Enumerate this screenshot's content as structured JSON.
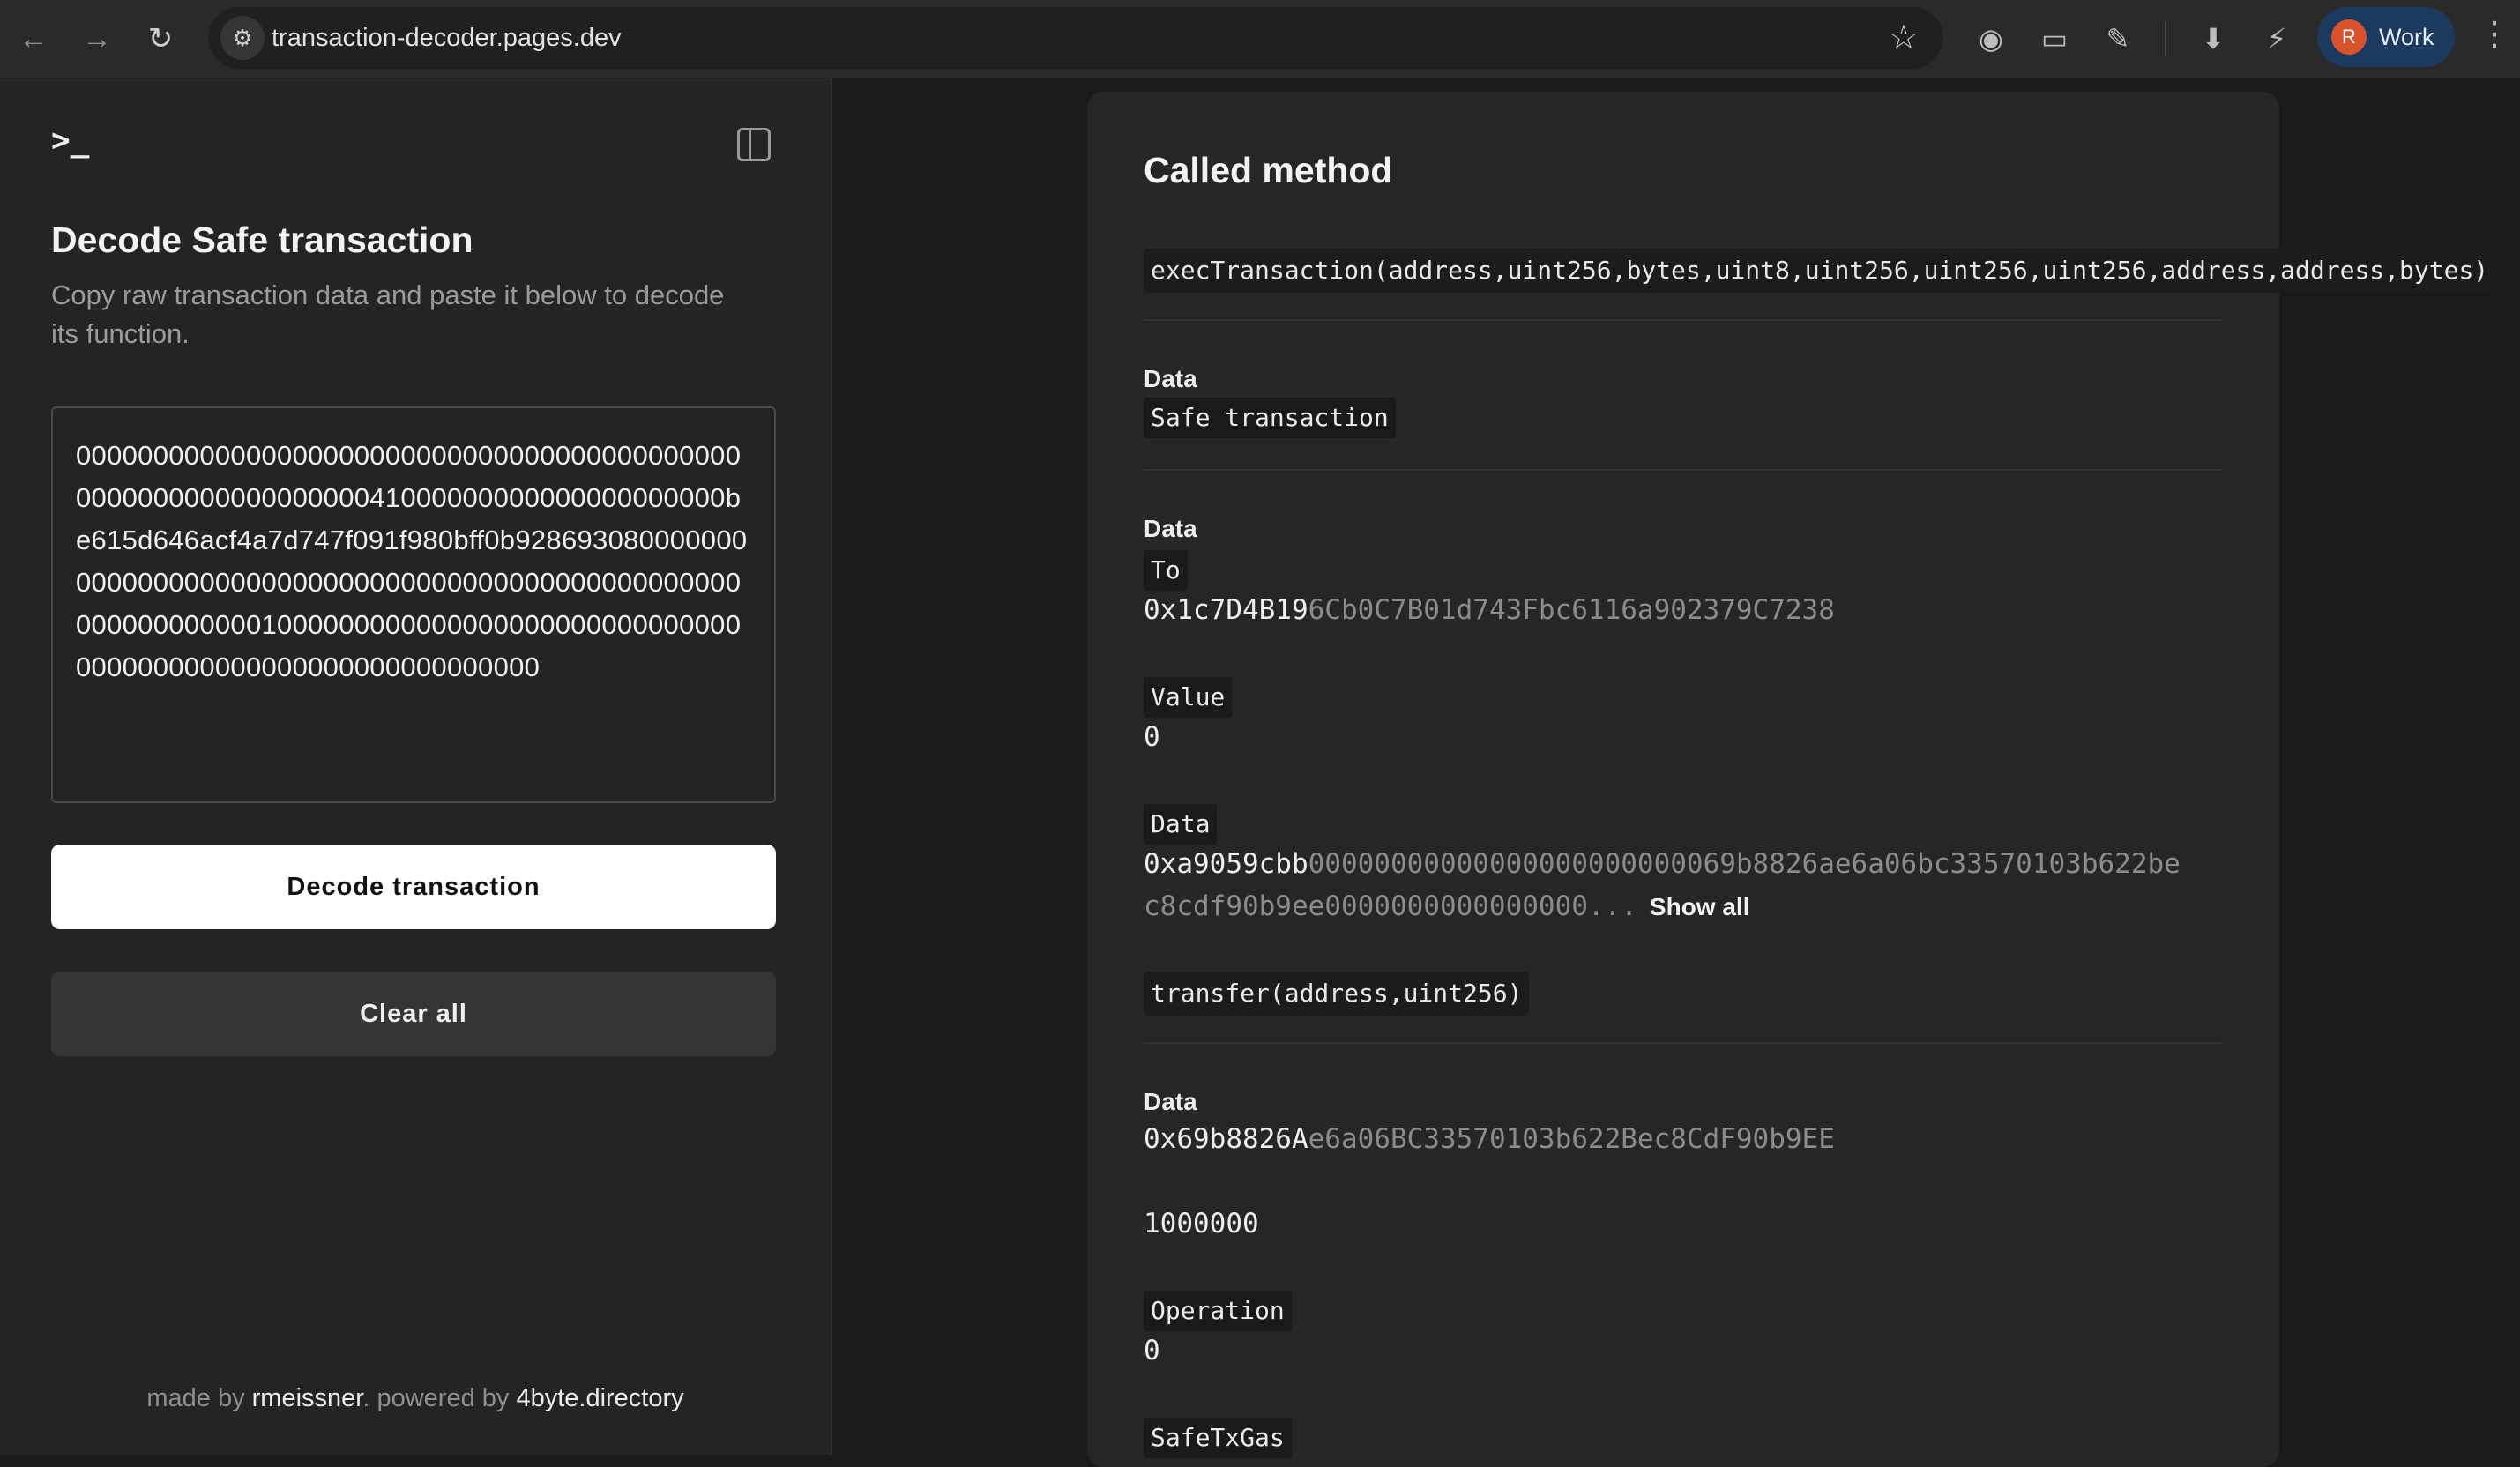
{
  "browser": {
    "url": "transaction-decoder.pages.dev",
    "profile_initial": "R",
    "profile_label": "Work"
  },
  "sidebar": {
    "title": "Decode Safe transaction",
    "subtitle": "Copy raw transaction data and paste it below to decode its function.",
    "raw_input_value": "0000000000000000000000000000000000000000000000000000000000000041000000000000000000000be615d646acf4a7d747f091f980bff0b92869308000000000000000000000000000000000000000000000000000000000000001000000000000000000000000000000000000000000000000000000000000",
    "decode_button": "Decode transaction",
    "clear_button": "Clear all",
    "footer": {
      "made_by_prefix": "made by ",
      "author": "rmeissner",
      "powered_prefix": ". powered by ",
      "powered_link": "4byte.directory"
    }
  },
  "result": {
    "title": "Called method",
    "method_signature": "execTransaction(address,uint256,bytes,uint8,uint256,uint256,uint256,address,address,bytes)",
    "section1": {
      "label": "Data",
      "value": "Safe transaction"
    },
    "section2": {
      "label": "Data",
      "to_tag": "To",
      "to_value_bold": "0x1c7D4B19",
      "to_value_dim": "6Cb0C7B01d743Fbc6116a902379C7238",
      "value_tag": "Value",
      "value_value": "0",
      "data_tag": "Data",
      "data_value_bold": "0xa9059cbb",
      "data_value_dim1": "00000000000000000000000069b8826ae6a06bc33570103b622be",
      "data_value_dim2": "c8cdf90b9ee0000000000000000...",
      "show_all": "Show all",
      "inner_method": "transfer(address,uint256)"
    },
    "section3": {
      "label": "Data",
      "address_bold": "0x69b8826A",
      "address_dim": "e6a06BC33570103b622Bec8CdF90b9EE",
      "amount": "1000000",
      "operation_tag": "Operation",
      "operation_value": "0",
      "safetxgas_tag": "SafeTxGas"
    }
  }
}
